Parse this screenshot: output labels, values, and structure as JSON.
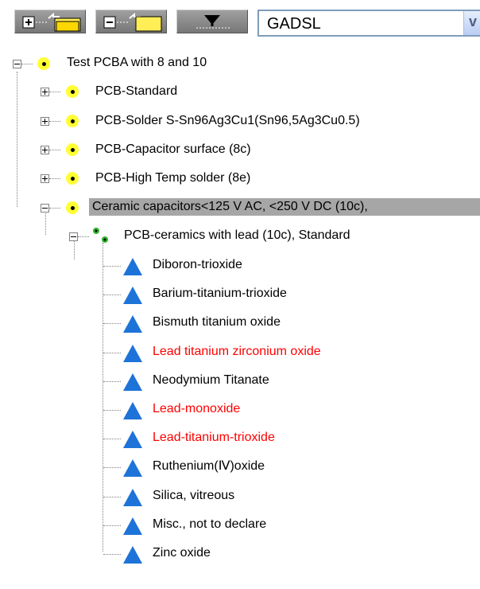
{
  "toolbar": {
    "combo_value": "GADSL"
  },
  "tree": {
    "root": "Test PCBA with 8 and 10",
    "children": [
      "PCB-Standard",
      "PCB-Solder S-Sn96Ag3Cu1(Sn96,5Ag3Cu0.5)",
      "PCB-Capacitor surface (8c)",
      "PCB-High Temp solder (8e)",
      "Ceramic capacitors<125 V AC, <250 V DC (10c),"
    ],
    "subnode": "PCB-ceramics with lead (10c), Standard",
    "leaves": [
      {
        "label": "Diboron-trioxide",
        "flag": false
      },
      {
        "label": "Barium-titanium-trioxide",
        "flag": false
      },
      {
        "label": "Bismuth titanium oxide",
        "flag": false
      },
      {
        "label": "Lead titanium zirconium oxide",
        "flag": true
      },
      {
        "label": "Neodymium Titanate",
        "flag": false
      },
      {
        "label": "Lead-monoxide",
        "flag": true
      },
      {
        "label": "Lead-titanium-trioxide",
        "flag": true
      },
      {
        "label": "Ruthenium(Ⅳ)oxide",
        "flag": false
      },
      {
        "label": "Silica, vitreous",
        "flag": false
      },
      {
        "label": "Misc., not to declare",
        "flag": false
      },
      {
        "label": "Zinc oxide",
        "flag": false
      }
    ]
  },
  "colors": {
    "flagged_text": "#ff0000",
    "selected_bg": "#a6a6a6",
    "leaf_icon": "#1e73d8",
    "node_icon": "#ffff33"
  },
  "icons": {
    "expand_all_button": "expand-all-folder-icon",
    "collapse_all_button": "collapse-all-folder-icon",
    "filter_button": "filter-down-arrow-icon"
  }
}
